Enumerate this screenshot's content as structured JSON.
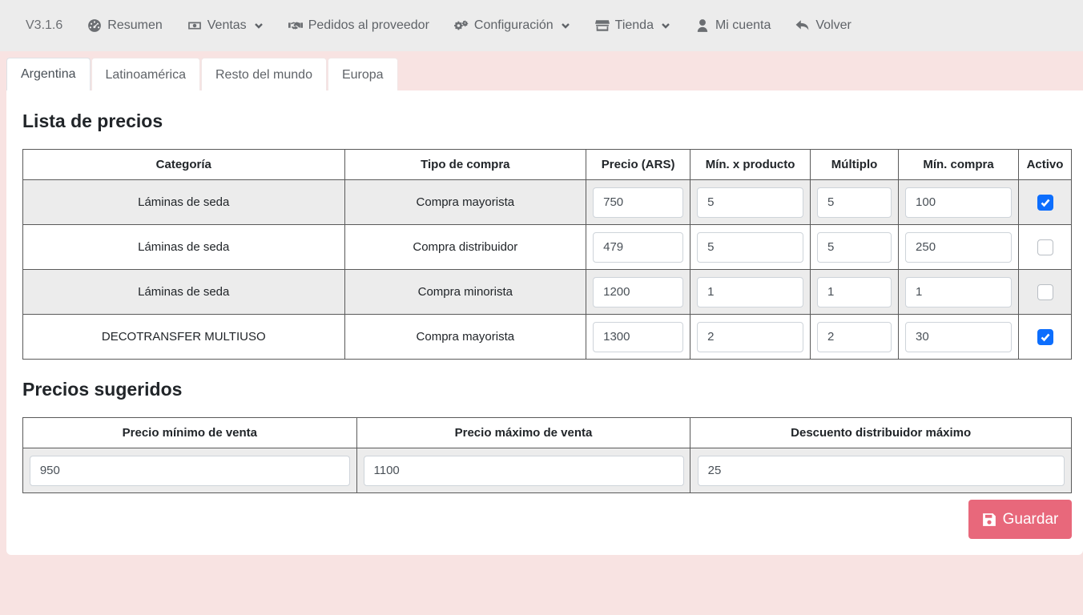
{
  "nav": {
    "version": "V3.1.6",
    "items": [
      {
        "label": "Resumen",
        "icon": "dashboard-icon",
        "dropdown": false
      },
      {
        "label": "Ventas",
        "icon": "money-icon",
        "dropdown": true
      },
      {
        "label": "Pedidos al proveedor",
        "icon": "handshake-icon",
        "dropdown": false
      },
      {
        "label": "Configuración",
        "icon": "gears-icon",
        "dropdown": true
      },
      {
        "label": "Tienda",
        "icon": "store-icon",
        "dropdown": true
      },
      {
        "label": "Mi cuenta",
        "icon": "user-icon",
        "dropdown": false
      },
      {
        "label": "Volver",
        "icon": "undo-icon",
        "dropdown": false
      }
    ]
  },
  "tabs": [
    "Argentina",
    "Latinoamérica",
    "Resto del mundo",
    "Europa"
  ],
  "active_tab": "Argentina",
  "price_list": {
    "title": "Lista de precios",
    "headers": [
      "Categoría",
      "Tipo de compra",
      "Precio (ARS)",
      "Mín. x producto",
      "Múltiplo",
      "Mín. compra",
      "Activo"
    ],
    "rows": [
      {
        "category": "Láminas de seda",
        "purchase_type": "Compra mayorista",
        "price": "750",
        "min_product": "5",
        "multiple": "5",
        "min_purchase": "100",
        "active": true
      },
      {
        "category": "Láminas de seda",
        "purchase_type": "Compra distribuidor",
        "price": "479",
        "min_product": "5",
        "multiple": "5",
        "min_purchase": "250",
        "active": false
      },
      {
        "category": "Láminas de seda",
        "purchase_type": "Compra minorista",
        "price": "1200",
        "min_product": "1",
        "multiple": "1",
        "min_purchase": "1",
        "active": false
      },
      {
        "category": "DECOTRANSFER MULTIUSO",
        "purchase_type": "Compra mayorista",
        "price": "1300",
        "min_product": "2",
        "multiple": "2",
        "min_purchase": "30",
        "active": true
      }
    ]
  },
  "suggested": {
    "title": "Precios sugeridos",
    "headers": [
      "Precio mínimo de venta",
      "Precio máximo de venta",
      "Descuento distribuidor máximo"
    ],
    "values": [
      "950",
      "1100",
      "25"
    ]
  },
  "save_button": {
    "label": "Guardar",
    "icon": "save-icon"
  },
  "colors": {
    "accent": "#e8687b",
    "checkbox": "#0d6efd",
    "background": "#f8e3e2",
    "navbar": "#ececec"
  }
}
